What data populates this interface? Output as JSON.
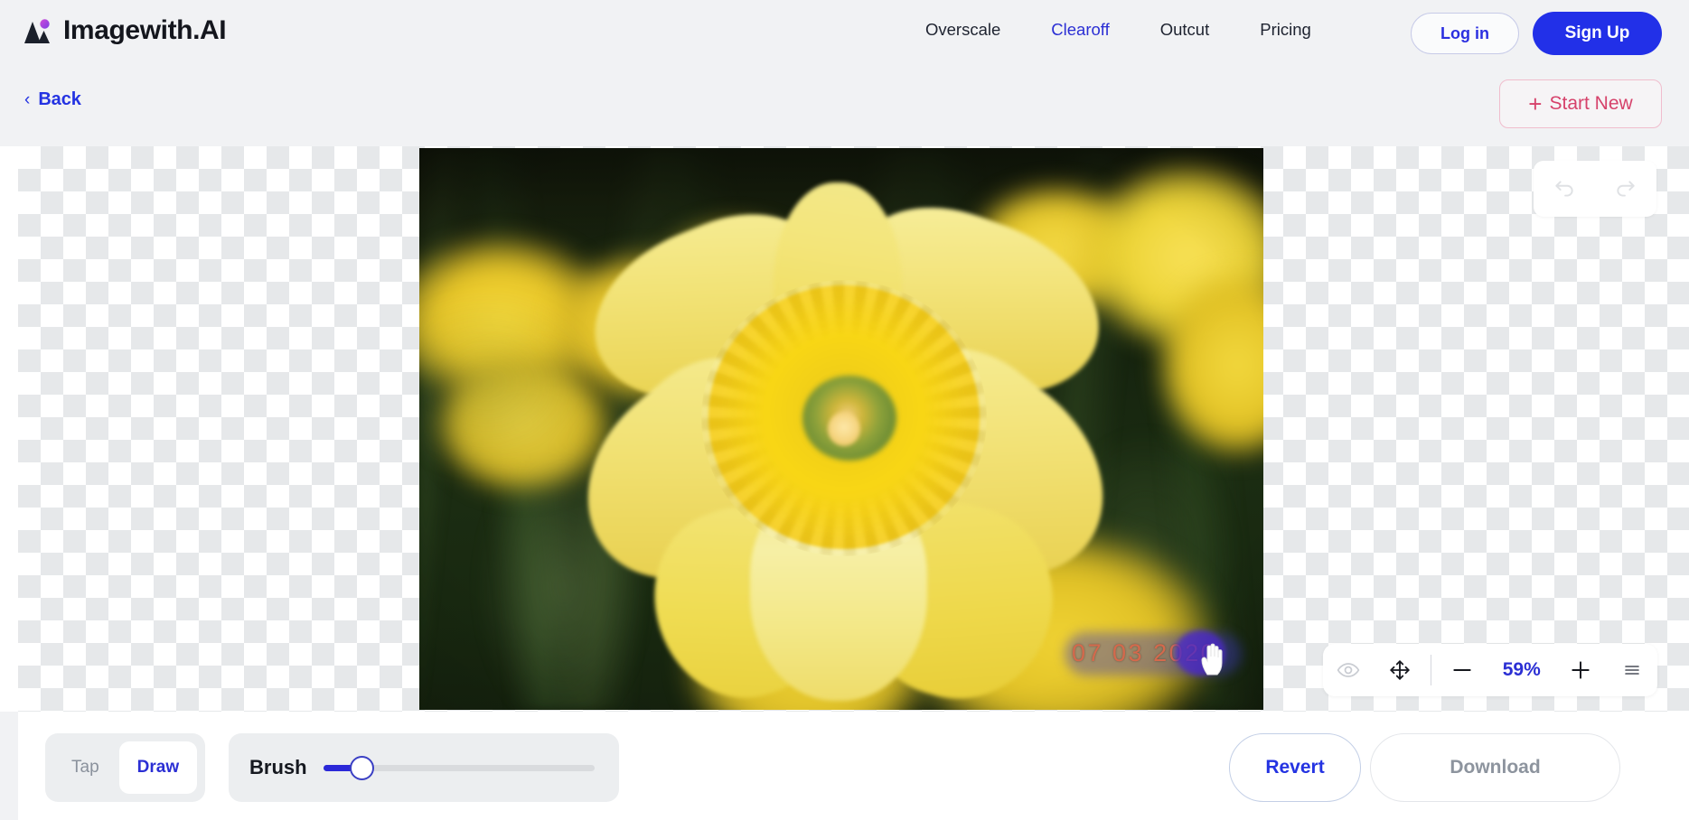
{
  "header": {
    "brand": "Imagewith.AI",
    "brand_logo_icon": "mountain-dot-logo-icon",
    "nav": [
      {
        "label": "Overscale",
        "active": false
      },
      {
        "label": "Clearoff",
        "active": true
      },
      {
        "label": "Outcut",
        "active": false
      },
      {
        "label": "Pricing",
        "active": false
      }
    ],
    "login_label": "Log in",
    "signup_label": "Sign Up"
  },
  "subbar": {
    "back_label": "Back",
    "back_icon": "chevron-left-icon",
    "start_new_label": "Start New",
    "start_new_icon": "plus-icon"
  },
  "canvas": {
    "image_alt": "Yellow daffodil flower close-up with blurred green background",
    "watermark_text": "07 03 2020",
    "watermark_color": "#d4694c",
    "brush_mask_color": "#3a34be",
    "cursor_icon": "hand-pointer-cursor"
  },
  "history": {
    "undo_icon": "undo-arrow-icon",
    "redo_icon": "redo-arrow-icon",
    "undo_enabled": false,
    "redo_enabled": false
  },
  "zoombar": {
    "eye_icon": "eye-icon",
    "move_icon": "move-arrows-icon",
    "minus_icon": "minus-icon",
    "zoom_level": "59%",
    "plus_icon": "plus-icon",
    "menu_icon": "hamburger-menu-icon",
    "accent_color": "#2b2fd4"
  },
  "toolbar": {
    "modes": [
      {
        "label": "Tap",
        "active": false
      },
      {
        "label": "Draw",
        "active": true
      }
    ],
    "brush_label": "Brush",
    "brush_value": 14,
    "revert_label": "Revert",
    "download_label": "Download",
    "download_enabled": false
  },
  "colors": {
    "page_bg": "#f1f2f4",
    "primary_blue": "#2230e8",
    "accent_indigo": "#2b2fd4",
    "start_new_pink": "#d6426b",
    "muted_gray": "#8d949e"
  }
}
